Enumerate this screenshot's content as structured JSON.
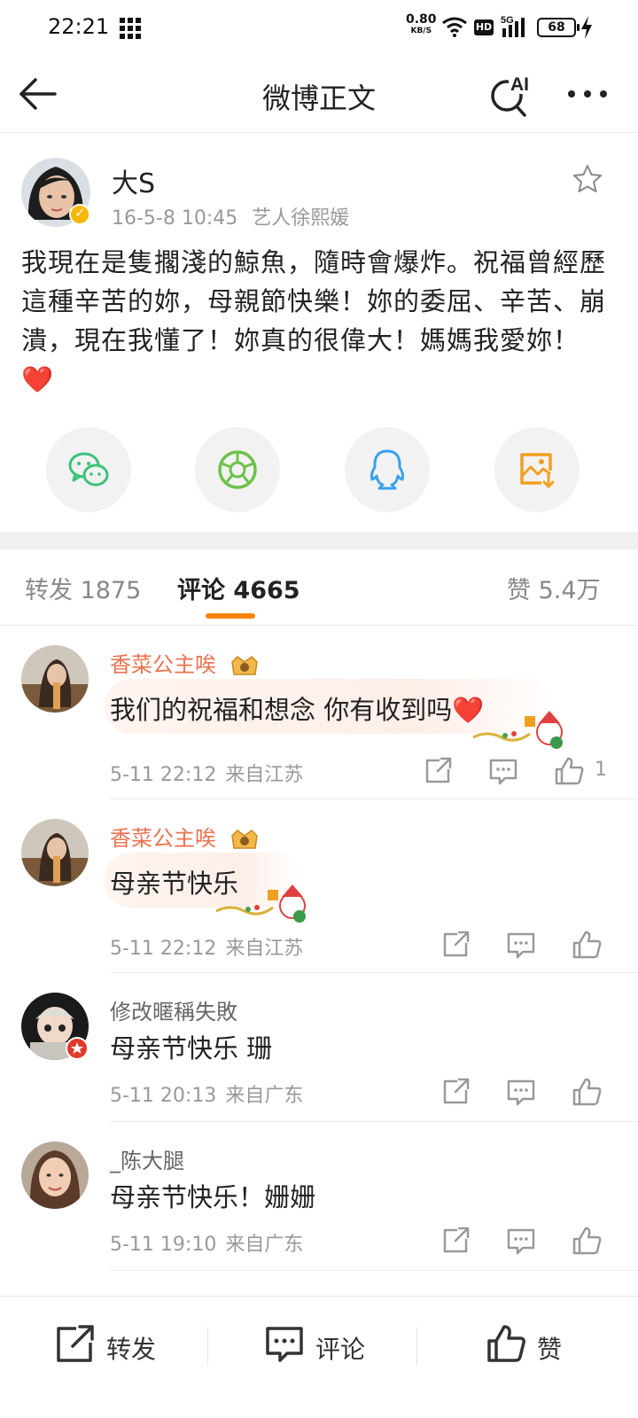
{
  "status_bar": {
    "time": "22:21",
    "net_speed": "0.80",
    "net_speed_unit": "KB/S",
    "hd": "HD",
    "network": "5G",
    "battery": "68"
  },
  "nav": {
    "title": "微博正文",
    "ai_label": "AI"
  },
  "post": {
    "author": "大S",
    "date": "16-5-8 10:45",
    "source": "艺人徐熙媛",
    "text": "我現在是隻擱淺的鯨魚，隨時會爆炸。祝福曾經歷這種辛苦的妳，母親節快樂！妳的委屈、辛苦、崩潰，現在我懂了！妳真的很偉大！媽媽我愛妳！",
    "heart": "❤️",
    "share_targets": [
      "wechat-icon",
      "moments-icon",
      "qq-icon",
      "save-image-icon"
    ]
  },
  "tabs": {
    "repost_label": "转发",
    "repost_count": "1875",
    "comment_label": "评论",
    "comment_count": "4665",
    "like_label": "赞",
    "like_count": "5.4万"
  },
  "comments": [
    {
      "name": "香菜公主唉",
      "text": "我们的祝福和想念 你有收到吗❤️",
      "date": "5-11 22:12",
      "location": "来自江苏",
      "likes": "1"
    },
    {
      "name": "香菜公主唉",
      "text": "母亲节快乐",
      "date": "5-11 22:12",
      "location": "来自江苏",
      "likes": ""
    },
    {
      "name": "修改暱稱失敗",
      "text": "母亲节快乐 珊",
      "date": "5-11 20:13",
      "location": "来自广东",
      "likes": ""
    },
    {
      "name": "_陈大腿",
      "text": "母亲节快乐！姗姗",
      "date": "5-11 19:10",
      "location": "来自广东",
      "likes": ""
    }
  ],
  "bottom_bar": {
    "repost": "转发",
    "comment": "评论",
    "like": "赞"
  },
  "colors": {
    "accent": "#ff8200",
    "name_orange": "#eb7350",
    "wechat": "#3cc27a",
    "moments": "#6cc24a",
    "qq": "#3aa0e8",
    "save": "#f0a020"
  }
}
